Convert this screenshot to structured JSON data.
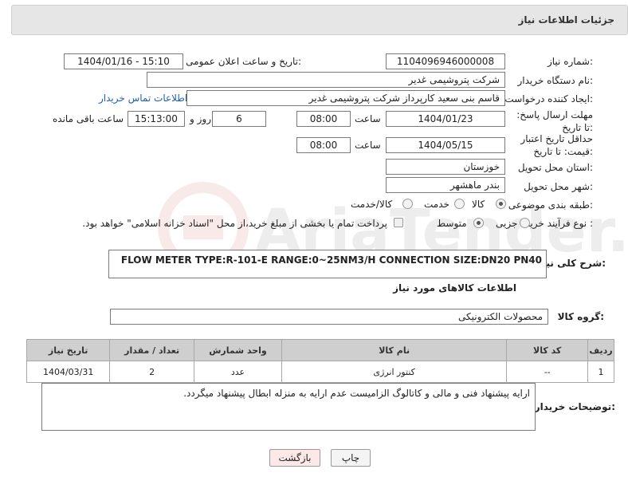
{
  "header": {
    "title": "جزئیات اطلاعات نیاز"
  },
  "form": {
    "need_number_label": "شماره نیاز:",
    "need_number": "1104096946000008",
    "announce_label": "تاریخ و ساعت اعلان عمومی:",
    "announce_value": "1404/01/16 - 15:10",
    "buyer_org_label": "نام دستگاه خریدار:",
    "buyer_org": "شرکت پتروشیمی غدیر",
    "creator_label": "ایجاد کننده درخواست:",
    "creator": "قاسم بنی سعید کارپرداز شرکت پتروشیمی غدیر",
    "contact_link": "اطلاعات تماس خریدار",
    "reply_deadline_label": "مهلت ارسال پاسخ: تا تاریخ:",
    "reply_date": "1404/01/23",
    "time_label": "ساعت",
    "reply_time": "08:00",
    "days_value": "6",
    "days_label": "روز و",
    "remaining_time": "15:13:00",
    "remaining_label": "ساعت باقی مانده",
    "validity_label": "حداقل تاریخ اعتبار قیمت: تا تاریخ:",
    "validity_date": "1404/05/15",
    "validity_time": "08:00",
    "province_label": "استان محل تحویل:",
    "province": "خوزستان",
    "city_label": "شهر محل تحویل:",
    "city": "بندر ماهشهر",
    "category_label": "طبقه بندی موضوعی:",
    "category_options": [
      "کالا",
      "خدمت",
      "کالا/خدمت"
    ],
    "category_selected": "کالا",
    "process_label": "نوع فرآیند خرید :",
    "process_options": [
      "جزیی",
      "متوسط"
    ],
    "process_selected": "متوسط",
    "payment_note": "پرداخت تمام یا بخشی از مبلغ خرید،از محل \"اسناد خزانه اسلامی\" خواهد بود."
  },
  "description": {
    "label": "شرح کلی نیاز:",
    "text": "FLOW METER TYPE:R-101-E RANGE:0~25NM3/H CONNECTION SIZE:DN20 PN40"
  },
  "goods_info": {
    "title": "اطلاعات کالاهای مورد نیاز",
    "group_label": "گروه کالا:",
    "group_value": "محصولات الکترونیکی",
    "table": {
      "headers": [
        "ردیف",
        "کد کالا",
        "نام کالا",
        "واحد شمارش",
        "تعداد / مقدار",
        "تاریخ نیاز"
      ],
      "rows": [
        [
          "1",
          "--",
          "کنتور انرژی",
          "عدد",
          "2",
          "1404/03/31"
        ]
      ]
    }
  },
  "buyer_notes": {
    "label": "توضیحات خریدار:",
    "text": "ارایه پیشنهاد فنی و مالی و کاتالوگ الزامیست عدم ارایه به منزله ابطال پیشنهاد میگردد."
  },
  "buttons": {
    "print": "چاپ",
    "back": "بازگشت"
  },
  "watermark": {
    "text": "AriaTender.net",
    "color": "#c0392b"
  }
}
